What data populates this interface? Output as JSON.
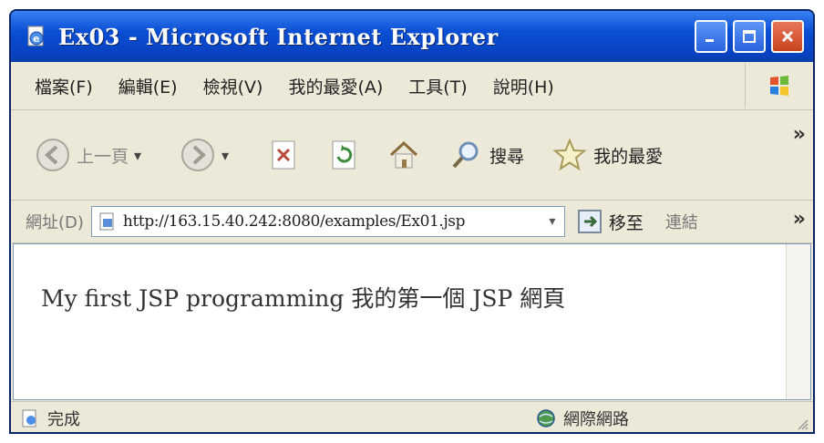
{
  "window": {
    "title": "Ex03 - Microsoft Internet Explorer"
  },
  "menu": {
    "items": [
      "檔案(F)",
      "編輯(E)",
      "檢視(V)",
      "我的最愛(A)",
      "工具(T)",
      "說明(H)"
    ]
  },
  "toolbar": {
    "back_label": "上一頁",
    "search_label": "搜尋",
    "favorites_label": "我的最愛",
    "more": "»"
  },
  "address": {
    "label": "網址(D)",
    "url": "http://163.15.40.242:8080/examples/Ex01.jsp",
    "go_label": "移至",
    "links_label": "連結",
    "more": "»"
  },
  "content": {
    "text": "My first JSP programming 我的第一個 JSP 網頁"
  },
  "status": {
    "left": "完成",
    "zone": "網際網路"
  },
  "icons": {
    "title_icon": "ie-page-icon",
    "back": "back-arrow-icon",
    "forward": "forward-arrow-icon",
    "stop": "stop-icon",
    "refresh": "refresh-icon",
    "home": "home-icon",
    "search": "search-icon",
    "favorites": "star-icon",
    "go": "go-arrow-icon",
    "status_page": "page-done-icon",
    "zone": "globe-icon"
  },
  "colors": {
    "titlebar": "#0a4fd4",
    "chrome": "#ece9d8",
    "content_bg": "#ffffff"
  }
}
